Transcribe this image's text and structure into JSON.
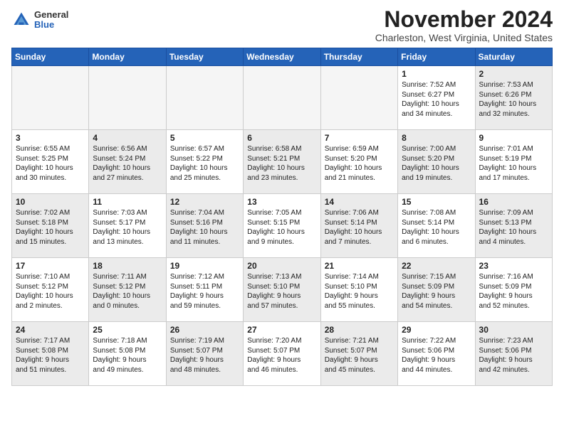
{
  "logo": {
    "general": "General",
    "blue": "Blue"
  },
  "title": "November 2024",
  "location": "Charleston, West Virginia, United States",
  "days_header": [
    "Sunday",
    "Monday",
    "Tuesday",
    "Wednesday",
    "Thursday",
    "Friday",
    "Saturday"
  ],
  "weeks": [
    [
      {
        "day": "",
        "info": "",
        "empty": true
      },
      {
        "day": "",
        "info": "",
        "empty": true
      },
      {
        "day": "",
        "info": "",
        "empty": true
      },
      {
        "day": "",
        "info": "",
        "empty": true
      },
      {
        "day": "",
        "info": "",
        "empty": true
      },
      {
        "day": "1",
        "info": "Sunrise: 7:52 AM\nSunset: 6:27 PM\nDaylight: 10 hours\nand 34 minutes.",
        "shaded": false
      },
      {
        "day": "2",
        "info": "Sunrise: 7:53 AM\nSunset: 6:26 PM\nDaylight: 10 hours\nand 32 minutes.",
        "shaded": true
      }
    ],
    [
      {
        "day": "3",
        "info": "Sunrise: 6:55 AM\nSunset: 5:25 PM\nDaylight: 10 hours\nand 30 minutes.",
        "shaded": false
      },
      {
        "day": "4",
        "info": "Sunrise: 6:56 AM\nSunset: 5:24 PM\nDaylight: 10 hours\nand 27 minutes.",
        "shaded": true
      },
      {
        "day": "5",
        "info": "Sunrise: 6:57 AM\nSunset: 5:22 PM\nDaylight: 10 hours\nand 25 minutes.",
        "shaded": false
      },
      {
        "day": "6",
        "info": "Sunrise: 6:58 AM\nSunset: 5:21 PM\nDaylight: 10 hours\nand 23 minutes.",
        "shaded": true
      },
      {
        "day": "7",
        "info": "Sunrise: 6:59 AM\nSunset: 5:20 PM\nDaylight: 10 hours\nand 21 minutes.",
        "shaded": false
      },
      {
        "day": "8",
        "info": "Sunrise: 7:00 AM\nSunset: 5:20 PM\nDaylight: 10 hours\nand 19 minutes.",
        "shaded": true
      },
      {
        "day": "9",
        "info": "Sunrise: 7:01 AM\nSunset: 5:19 PM\nDaylight: 10 hours\nand 17 minutes.",
        "shaded": false
      }
    ],
    [
      {
        "day": "10",
        "info": "Sunrise: 7:02 AM\nSunset: 5:18 PM\nDaylight: 10 hours\nand 15 minutes.",
        "shaded": true
      },
      {
        "day": "11",
        "info": "Sunrise: 7:03 AM\nSunset: 5:17 PM\nDaylight: 10 hours\nand 13 minutes.",
        "shaded": false
      },
      {
        "day": "12",
        "info": "Sunrise: 7:04 AM\nSunset: 5:16 PM\nDaylight: 10 hours\nand 11 minutes.",
        "shaded": true
      },
      {
        "day": "13",
        "info": "Sunrise: 7:05 AM\nSunset: 5:15 PM\nDaylight: 10 hours\nand 9 minutes.",
        "shaded": false
      },
      {
        "day": "14",
        "info": "Sunrise: 7:06 AM\nSunset: 5:14 PM\nDaylight: 10 hours\nand 7 minutes.",
        "shaded": true
      },
      {
        "day": "15",
        "info": "Sunrise: 7:08 AM\nSunset: 5:14 PM\nDaylight: 10 hours\nand 6 minutes.",
        "shaded": false
      },
      {
        "day": "16",
        "info": "Sunrise: 7:09 AM\nSunset: 5:13 PM\nDaylight: 10 hours\nand 4 minutes.",
        "shaded": true
      }
    ],
    [
      {
        "day": "17",
        "info": "Sunrise: 7:10 AM\nSunset: 5:12 PM\nDaylight: 10 hours\nand 2 minutes.",
        "shaded": false
      },
      {
        "day": "18",
        "info": "Sunrise: 7:11 AM\nSunset: 5:12 PM\nDaylight: 10 hours\nand 0 minutes.",
        "shaded": true
      },
      {
        "day": "19",
        "info": "Sunrise: 7:12 AM\nSunset: 5:11 PM\nDaylight: 9 hours\nand 59 minutes.",
        "shaded": false
      },
      {
        "day": "20",
        "info": "Sunrise: 7:13 AM\nSunset: 5:10 PM\nDaylight: 9 hours\nand 57 minutes.",
        "shaded": true
      },
      {
        "day": "21",
        "info": "Sunrise: 7:14 AM\nSunset: 5:10 PM\nDaylight: 9 hours\nand 55 minutes.",
        "shaded": false
      },
      {
        "day": "22",
        "info": "Sunrise: 7:15 AM\nSunset: 5:09 PM\nDaylight: 9 hours\nand 54 minutes.",
        "shaded": true
      },
      {
        "day": "23",
        "info": "Sunrise: 7:16 AM\nSunset: 5:09 PM\nDaylight: 9 hours\nand 52 minutes.",
        "shaded": false
      }
    ],
    [
      {
        "day": "24",
        "info": "Sunrise: 7:17 AM\nSunset: 5:08 PM\nDaylight: 9 hours\nand 51 minutes.",
        "shaded": true
      },
      {
        "day": "25",
        "info": "Sunrise: 7:18 AM\nSunset: 5:08 PM\nDaylight: 9 hours\nand 49 minutes.",
        "shaded": false
      },
      {
        "day": "26",
        "info": "Sunrise: 7:19 AM\nSunset: 5:07 PM\nDaylight: 9 hours\nand 48 minutes.",
        "shaded": true
      },
      {
        "day": "27",
        "info": "Sunrise: 7:20 AM\nSunset: 5:07 PM\nDaylight: 9 hours\nand 46 minutes.",
        "shaded": false
      },
      {
        "day": "28",
        "info": "Sunrise: 7:21 AM\nSunset: 5:07 PM\nDaylight: 9 hours\nand 45 minutes.",
        "shaded": true
      },
      {
        "day": "29",
        "info": "Sunrise: 7:22 AM\nSunset: 5:06 PM\nDaylight: 9 hours\nand 44 minutes.",
        "shaded": false
      },
      {
        "day": "30",
        "info": "Sunrise: 7:23 AM\nSunset: 5:06 PM\nDaylight: 9 hours\nand 42 minutes.",
        "shaded": true
      }
    ]
  ]
}
